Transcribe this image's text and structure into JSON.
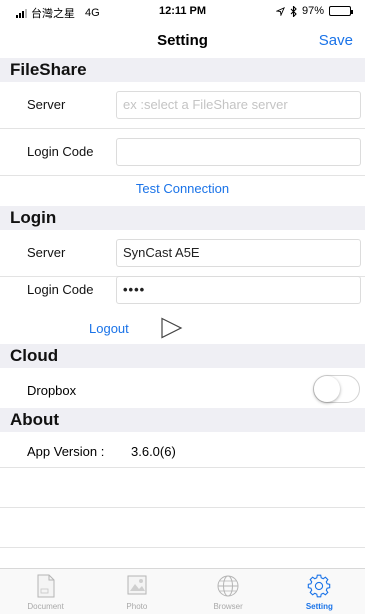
{
  "status_bar": {
    "carrier": "台灣之星",
    "network": "4G",
    "time": "12:11 PM",
    "battery": "97%",
    "battery_level": 0.97
  },
  "nav": {
    "title": "Setting",
    "save_label": "Save"
  },
  "fileshare": {
    "header": "FileShare",
    "server_label": "Server",
    "server_value": "",
    "server_placeholder": "ex :select a FileShare server",
    "login_code_label": "Login Code",
    "login_code_value": "",
    "test_connection_label": "Test Connection"
  },
  "login": {
    "header": "Login",
    "server_label": "Server",
    "server_value": "SynCast A5E",
    "login_code_label": "Login Code",
    "login_code_value": "••••",
    "logout_label": "Logout"
  },
  "cloud": {
    "header": "Cloud",
    "dropbox_label": "Dropbox",
    "dropbox_enabled": false
  },
  "about": {
    "header": "About",
    "app_version_label": "App Version :",
    "app_version_value": "3.6.0(6)"
  },
  "tabs": [
    {
      "label": "Document",
      "icon": "document-icon",
      "active": false
    },
    {
      "label": "Photo",
      "icon": "photo-icon",
      "active": false
    },
    {
      "label": "Browser",
      "icon": "globe-icon",
      "active": false
    },
    {
      "label": "Setting",
      "icon": "gear-icon",
      "active": true
    }
  ],
  "colors": {
    "accent": "#1a73e8",
    "section_bg": "#efeff4",
    "inactive_tab": "#a9a9a9"
  }
}
